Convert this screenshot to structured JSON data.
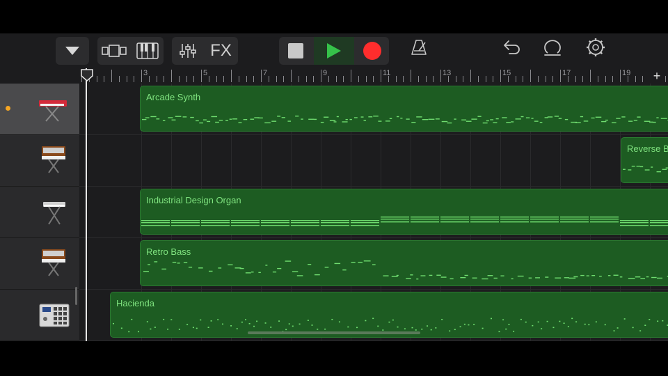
{
  "toolbar": {
    "buttons": [
      {
        "name": "track-menu-button",
        "icon": "triangle-down-icon"
      },
      {
        "name": "tracks-view-button",
        "icon": "tracks-view-icon"
      },
      {
        "name": "keyboard-button",
        "icon": "piano-keys-icon"
      },
      {
        "name": "mixer-button",
        "icon": "sliders-icon"
      },
      {
        "name": "fx-button",
        "label": "FX"
      },
      {
        "name": "stop-button",
        "icon": "stop-icon"
      },
      {
        "name": "play-button",
        "icon": "play-icon"
      },
      {
        "name": "record-button",
        "icon": "record-icon"
      },
      {
        "name": "metronome-button",
        "icon": "metronome-icon"
      },
      {
        "name": "undo-button",
        "icon": "undo-icon"
      },
      {
        "name": "loop-browser-button",
        "icon": "loop-icon"
      },
      {
        "name": "settings-button",
        "icon": "gear-icon"
      }
    ],
    "fx_label": "FX"
  },
  "ruler": {
    "bar_numbers": [
      "3",
      "5",
      "7",
      "9",
      "11",
      "13",
      "15",
      "17",
      "19"
    ],
    "add_label": "+"
  },
  "tracks": [
    {
      "instrument": "red-keyboard-icon",
      "selected": true,
      "region": {
        "name": "Arcade Synth"
      }
    },
    {
      "instrument": "analog-synth-icon",
      "selected": false,
      "region": {
        "name": "Reverse B"
      }
    },
    {
      "instrument": "white-keyboard-icon",
      "selected": false,
      "region": {
        "name": "Industrial Design Organ"
      }
    },
    {
      "instrument": "analog-synth-icon",
      "selected": false,
      "region": {
        "name": "Retro Bass"
      }
    },
    {
      "instrument": "drum-machine-icon",
      "selected": false,
      "region": {
        "name": "Hacienda"
      }
    }
  ],
  "colors": {
    "region_fill": "#1d5c22",
    "region_text": "#7fe37f",
    "play_green": "#36c24a",
    "record_red": "#ff2d2d",
    "record_arm": "#f5a623"
  }
}
